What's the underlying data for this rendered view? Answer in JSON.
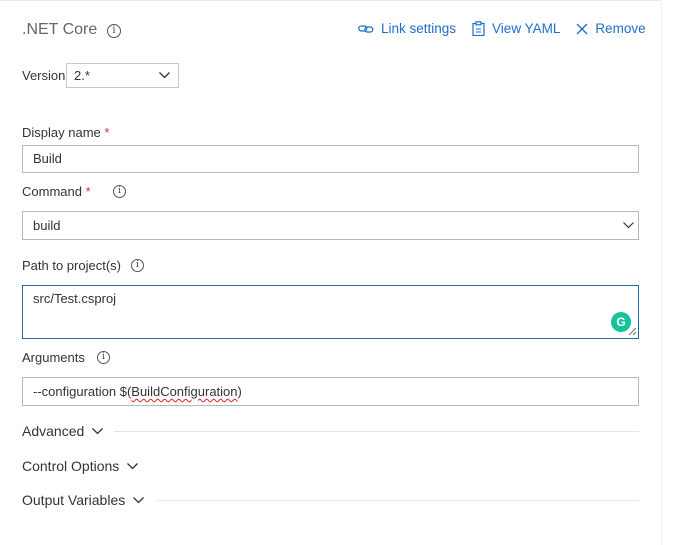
{
  "header": {
    "title": ".NET Core",
    "actions": {
      "link_settings": "Link settings",
      "view_yaml": "View YAML",
      "remove": "Remove"
    }
  },
  "version": {
    "label": "Version",
    "value": "2.*"
  },
  "display_name": {
    "label": "Display name",
    "required_mark": "*",
    "value": "Build"
  },
  "command": {
    "label": "Command",
    "required_mark": "*",
    "value": "build"
  },
  "path_to_projects": {
    "label": "Path to project(s)",
    "value": "src/Test.csproj"
  },
  "arguments": {
    "label": "Arguments",
    "value_prefix": "--configuration $(",
    "value_misspelled": "BuildConfiguration",
    "value_suffix": ")"
  },
  "sections": {
    "advanced": "Advanced",
    "control_options": "Control Options",
    "output_variables": "Output Variables"
  },
  "colors": {
    "link": "#1e6ec8",
    "required": "#d13438",
    "focus_border": "#1c6aa8",
    "grammarly": "#15c39a"
  },
  "icons": {
    "info": "info-icon",
    "link": "link-icon",
    "yaml": "clipboard-icon",
    "remove": "close-icon",
    "dropdown": "chevron-down-icon",
    "grammarly": "grammarly-icon"
  }
}
